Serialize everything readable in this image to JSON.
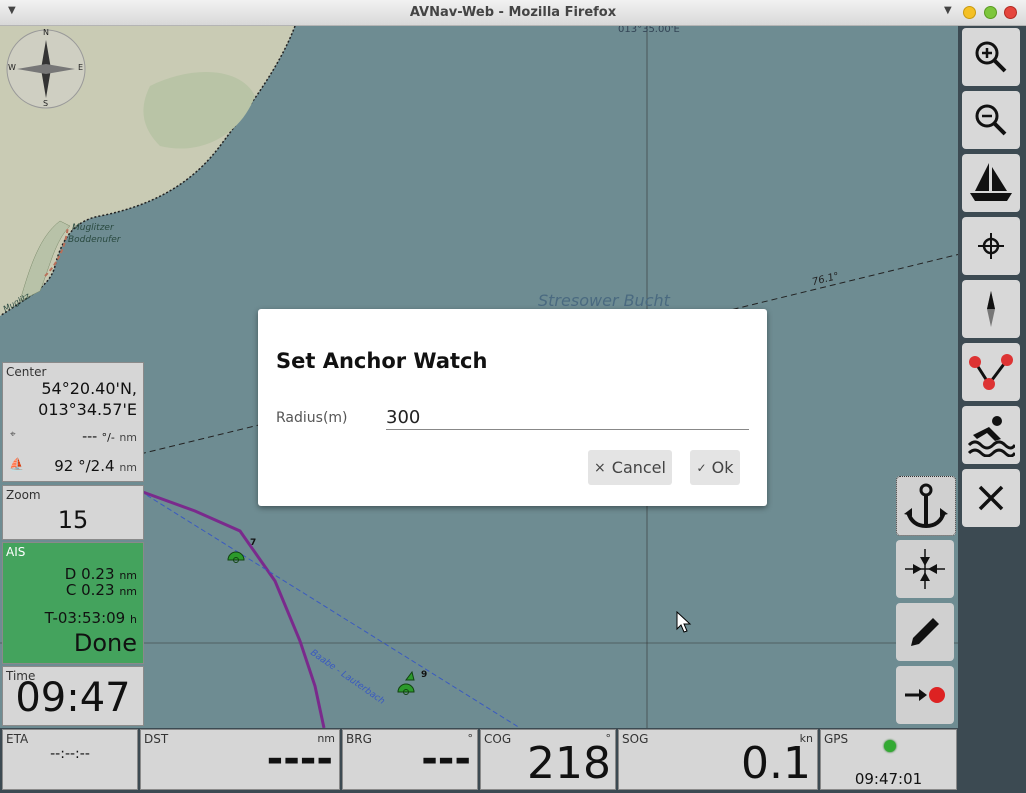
{
  "window": {
    "title": "AVNav-Web - Mozilla Firefox"
  },
  "map": {
    "coord_label": "013°35.00'E",
    "place_label": "Stresower Bucht",
    "shore_label_1": "Muglitzer",
    "shore_label_2": "Boddenufer",
    "shore_label_3": "Muglitz",
    "bearing_label": "76.1°",
    "route_label": "Baabe - Lauterbach",
    "buoy_7": "7",
    "buoy_9": "9",
    "compass": {
      "n": "N",
      "s": "S",
      "e": "E",
      "w": "W"
    }
  },
  "widgets": {
    "center": {
      "label": "Center",
      "lat": "54°20.40'N,",
      "lon": "013°34.57'E",
      "marker_value": "---",
      "marker_unit": "°/-",
      "marker_dist_unit": "nm",
      "boat_value": "92",
      "boat_unit": "°/2.4",
      "boat_dist_unit": "nm"
    },
    "zoom": {
      "label": "Zoom",
      "value": "15"
    },
    "ais": {
      "label": "AIS",
      "d_label": "D",
      "d_value": "0.23",
      "d_unit": "nm",
      "c_label": "C",
      "c_value": "0.23",
      "c_unit": "nm",
      "t_value": "T-03:53:09",
      "t_unit": "h",
      "status": "Done"
    },
    "time": {
      "label": "Time",
      "value": "09:47"
    },
    "eta": {
      "label": "ETA",
      "value": "--:--:--"
    },
    "dst": {
      "label": "DST",
      "unit": "nm",
      "value": "----"
    },
    "brg": {
      "label": "BRG",
      "unit": "°",
      "value": "---"
    },
    "cog": {
      "label": "COG",
      "unit": "°",
      "value": "218"
    },
    "sog": {
      "label": "SOG",
      "unit": "kn",
      "value": "0.1"
    },
    "gps": {
      "label": "GPS",
      "time": "09:47:01",
      "status_color": "#33aa33"
    }
  },
  "dialog": {
    "title": "Set Anchor Watch",
    "radius_label": "Radius(m)",
    "radius_value": "300",
    "cancel_icon": "×",
    "cancel_label": "Cancel",
    "ok_icon": "✓",
    "ok_label": "Ok"
  },
  "colors": {
    "ais_bg": "#44a35d",
    "route": "#7a2a8c",
    "water": "#6e8c92",
    "land": "#c9cbb4"
  }
}
